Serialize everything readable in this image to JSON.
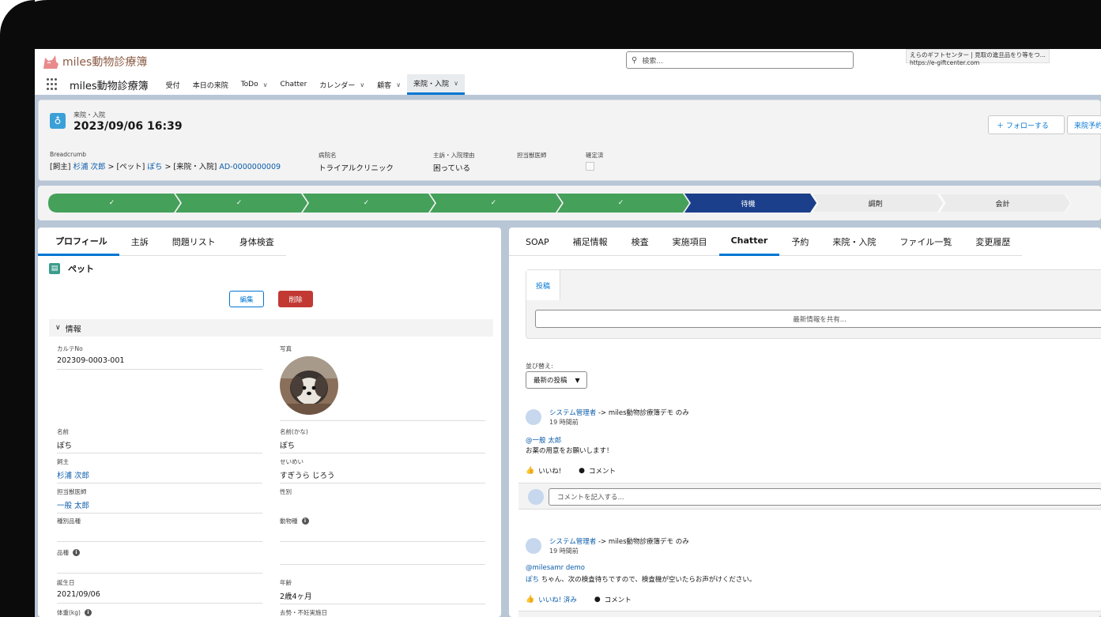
{
  "app": {
    "logo_text": "miles動物診療簿",
    "name": "miles動物診療簿",
    "search_placeholder": "検索...",
    "tooltip_line1": "えらのギフトセンター | 見取の進旦品をり等をつ...",
    "tooltip_line2": "https://e-giftcenter.com"
  },
  "nav": {
    "items": [
      {
        "label": "受付"
      },
      {
        "label": "本日の来院"
      },
      {
        "label": "ToDo",
        "dropdown": true
      },
      {
        "label": "Chatter"
      },
      {
        "label": "カレンダー",
        "dropdown": true
      },
      {
        "label": "顧客",
        "dropdown": true
      },
      {
        "label": "来院・入院",
        "dropdown": true,
        "active": true
      }
    ]
  },
  "record": {
    "object_label": "来院・入院",
    "title": "2023/09/06 16:39",
    "follow_button": "＋ フォローする",
    "visit_button": "来院予約",
    "fields": {
      "breadcrumb_label": "Breadcrumb",
      "breadcrumb_prefix1": "[飼主] ",
      "owner_link": "杉浦 次郎",
      "breadcrumb_prefix2": " > [ペット] ",
      "pet_link": "ぽち",
      "breadcrumb_prefix3": " > [来院・入院] ",
      "record_link": "AD-0000000009",
      "hospital_label": "病院名",
      "hospital_value": "トライアルクリニック",
      "complaint_label": "主訴・入院理由",
      "complaint_value": "困っている",
      "vet_label": "担当獣医師",
      "confirmed_label": "確定済"
    }
  },
  "path": {
    "steps": [
      {
        "label": "✓",
        "state": "done"
      },
      {
        "label": "✓",
        "state": "done"
      },
      {
        "label": "✓",
        "state": "done"
      },
      {
        "label": "✓",
        "state": "done"
      },
      {
        "label": "✓",
        "state": "done"
      },
      {
        "label": "待機",
        "state": "current"
      },
      {
        "label": "調剤",
        "state": "todo"
      },
      {
        "label": "会計",
        "state": "todo"
      }
    ],
    "colors": {
      "done": "#45a05a",
      "current": "#1b3f8a",
      "todo": "#ebebeb"
    }
  },
  "left": {
    "tabs": [
      "プロフィール",
      "主訴",
      "問題リスト",
      "身体検査"
    ],
    "section_title": "ペット",
    "edit_button": "編集",
    "delete_button": "削除",
    "info_section": "情報",
    "fields": {
      "chart_no_label": "カルテNo",
      "chart_no": "202309-0003-001",
      "photo_label": "写真",
      "name_label": "名前",
      "name": "ぽち",
      "kana_label": "名前(かな)",
      "kana": "ぽち",
      "owner_label": "飼主",
      "owner": "杉浦 次郎",
      "owner_kana_label": "せいめい",
      "owner_kana": "すぎうら じろう",
      "vet_label": "担当獣医師",
      "vet": "一般 太郎",
      "sex_label": "性別",
      "breed_type_label": "種別品種",
      "animal_label": "動物種",
      "breed_label": "品種",
      "birth_label": "誕生日",
      "birth": "2021/09/06",
      "age_label": "年齢",
      "age": "2歳4ヶ月",
      "weight_label": "体重(kg)",
      "neuter_label": "去勢・不妊実施日"
    }
  },
  "right": {
    "tabs": [
      "SOAP",
      "補足情報",
      "検査",
      "実施項目",
      "Chatter",
      "予約",
      "来院・入院",
      "ファイル一覧",
      "変更履歴"
    ],
    "active_tab": "Chatter",
    "publisher_tab": "投稿",
    "publisher_placeholder": "最新情報を共有...",
    "sort_label": "並び替え:",
    "sort_value": "最新の投稿",
    "comment_placeholder": "コメントを記入する...",
    "posts": [
      {
        "author": "システム管理者",
        "target": " -> miles動物診療簿デモ のみ",
        "time": "19 時間前",
        "mention": "@一般 太郎",
        "body_link": "",
        "body": "お薬の用意をお願いします！",
        "like": "いいね!",
        "comment": "コメント"
      },
      {
        "author": "システム管理者",
        "target": " -> miles動物診療簿デモ のみ",
        "time": "19 時間前",
        "mention": "@milesamr demo",
        "body_link": "ぽち",
        "body": " ちゃん、次の検査待ちですので、検査機が空いたらお声がけください。",
        "like": "いいね! 済み",
        "comment": "コメント"
      }
    ]
  }
}
